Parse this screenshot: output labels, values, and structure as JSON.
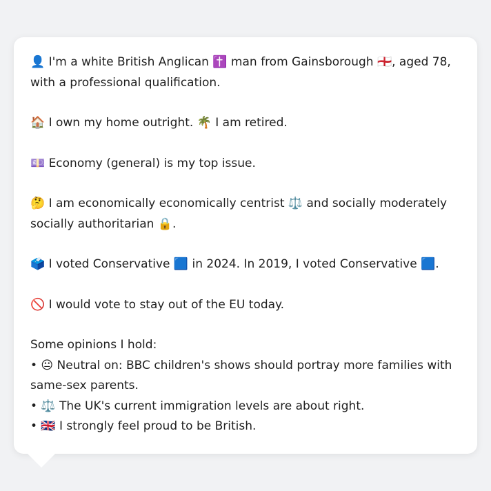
{
  "profile": {
    "p1": "👤 I'm a white British Anglican ✝️ man from Gainsborough 🏴󠁧󠁢󠁥󠁮󠁧󠁿, aged 78, with a professional qualification.",
    "p2": "🏠 I own my home outright. 🌴 I am retired.",
    "p3": "💷 Economy (general) is my top issue.",
    "p4": "🤔 I am economically economically centrist ⚖️ and socially moderately socially authoritarian 🔒.",
    "p5": "🗳️ I voted Conservative 🟦 in 2024. In 2019, I voted Conservative 🟦.",
    "p6": "🚫 I would vote to stay out of the EU today.",
    "opinions_heading": "Some opinions I hold:",
    "opinions": [
      "• 😐 Neutral on: BBC children's shows should portray more families with same-sex parents.",
      "• ⚖️ The UK's current immigration levels are about right.",
      "• 🇬🇧 I strongly feel proud to be British."
    ]
  }
}
